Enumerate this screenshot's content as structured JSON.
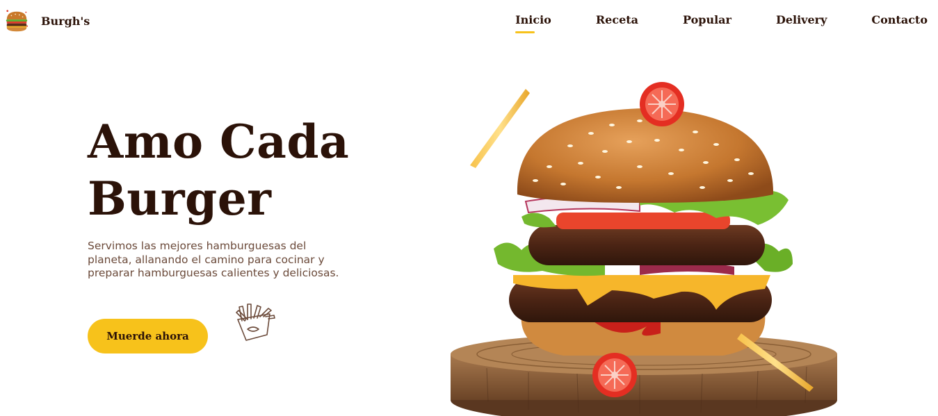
{
  "brand": {
    "name": "Burgh's",
    "logo_icon": "burger-icon"
  },
  "nav": {
    "items": [
      {
        "label": "Inicio",
        "active": true
      },
      {
        "label": "Receta",
        "active": false
      },
      {
        "label": "Popular",
        "active": false
      },
      {
        "label": "Delivery",
        "active": false
      },
      {
        "label": "Contacto",
        "active": false
      }
    ]
  },
  "hero": {
    "title_line1": "Amo Cada",
    "title_line2": "Burger",
    "description": "Servimos las mejores hamburguesas del planeta, allanando el camino para cocinar y preparar hamburguesas calientes y deliciosas.",
    "cta_label": "Muerde ahora",
    "doodle_icon": "fries-doodle-icon"
  },
  "colors": {
    "accent": "#f7c21b",
    "text_dark": "#2b1208",
    "text_muted": "#6b4a3a",
    "background": "#ffffff"
  },
  "images": {
    "burger": "burger-illustration",
    "board": "wooden-board",
    "tomato": "tomato-slice-icon",
    "fry": "french-fry-icon"
  }
}
